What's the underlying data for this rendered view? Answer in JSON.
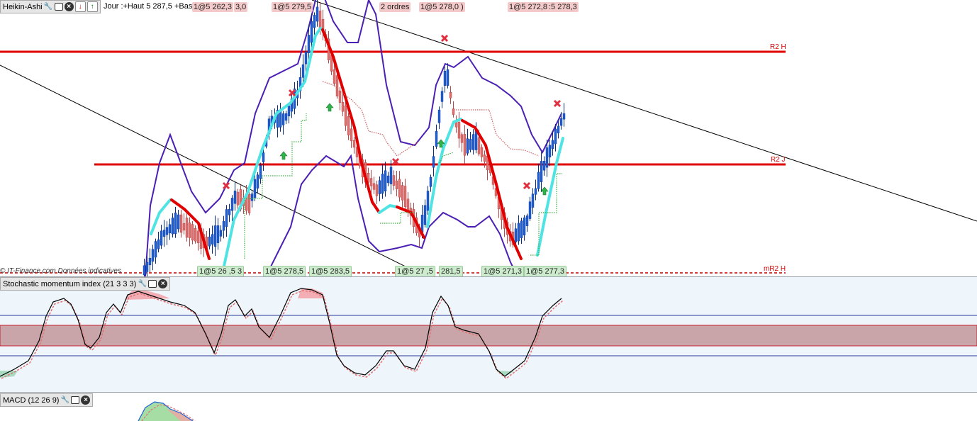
{
  "price_panel": {
    "chart_type_label": "Heikin-Ashi",
    "info_text": "Jour :+Haut 5 287,5 +Bas 5 262,3",
    "footer_text": "© IT-Finance.com  Données indicatives",
    "order_tags_top": [
      {
        "text": "1@5 262,3",
        "kind": "sell"
      },
      {
        "text": "3,0",
        "kind": "sell"
      },
      {
        "text": "1@5 279,5",
        "kind": "sell"
      },
      {
        "text": "2 ordres",
        "kind": "sell"
      },
      {
        "text": "1@5 278,0 )",
        "kind": "sell"
      },
      {
        "text": "1@5 272,8",
        "kind": "sell"
      },
      {
        "text": ":5 278,3",
        "kind": "sell"
      }
    ],
    "order_tags_bottom": [
      {
        "text": "1@5 26 ,5 3",
        "kind": "buy"
      },
      {
        "text": "1@5 278,5",
        "kind": "buy"
      },
      {
        "text": "1@5 283,5",
        "kind": "buy"
      },
      {
        "text": "1@5 27 ,5",
        "kind": "buy"
      },
      {
        "text": "281,5",
        "kind": "buy"
      },
      {
        "text": "1@5 271,3",
        "kind": "buy"
      },
      {
        "text": "1@5 277,3",
        "kind": "buy"
      }
    ],
    "levels": [
      {
        "label": "R2 H",
        "color": "#e00000",
        "style": "solid"
      },
      {
        "label": "R2 J",
        "color": "#e00000",
        "style": "solid"
      },
      {
        "label": "mR2 H",
        "color": "#c00000",
        "style": "dashed"
      }
    ],
    "colors": {
      "bull_candle": "#1f5fd6",
      "bear_candle": "#e07070",
      "bollinger": "#4b1fb3",
      "trend_up": "#4fe3e3",
      "trend_down": "#e00000",
      "stop_up": "#3cb043",
      "stop_down": "#d06060"
    }
  },
  "stochastic_panel": {
    "label": "Stochastic momentum index (21 3 3 3)",
    "colors": {
      "line": "#000000",
      "signal": "#e07070",
      "zone": "#c9a4a8",
      "overbought_fill": "#f2a0a8",
      "oversold_fill": "#9ed6b6"
    }
  },
  "macd_panel": {
    "label": "MACD (12 26 9)",
    "colors": {
      "line": "#1f5fd6",
      "signal": "#e07070",
      "fill_up": "#8fd48f",
      "fill_down": "#f3a3a3"
    }
  },
  "chart_data": {
    "type": "candlestick",
    "title": "",
    "series": [
      {
        "name": "Heikin-Ashi",
        "values": []
      },
      {
        "name": "Stochastic momentum index (21 3 3 3)",
        "values": []
      },
      {
        "name": "MACD (12 26 9)",
        "values": []
      }
    ]
  }
}
